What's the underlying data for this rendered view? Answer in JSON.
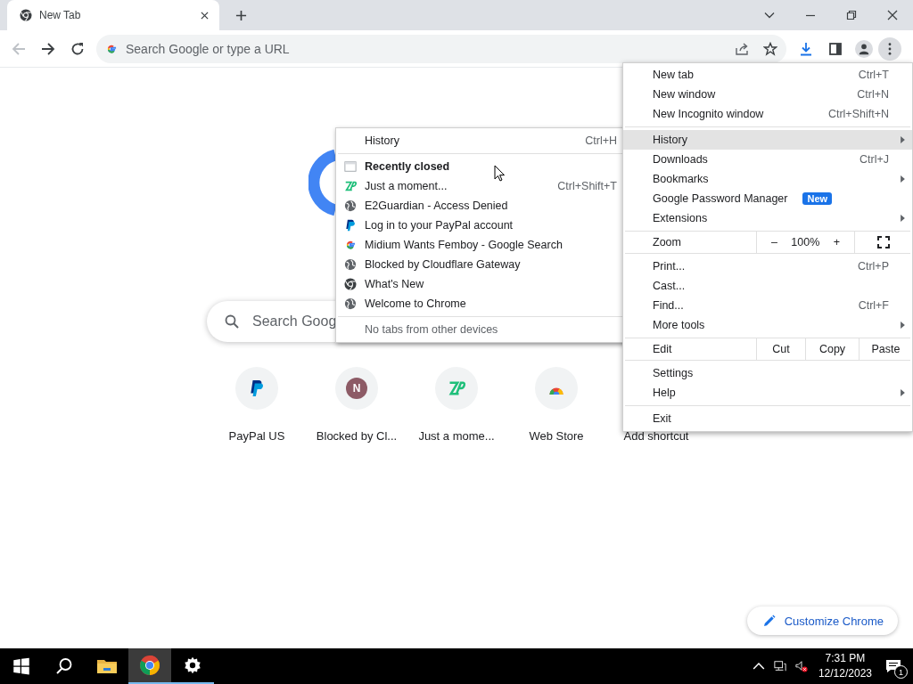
{
  "tab": {
    "title": "New Tab"
  },
  "address_bar": {
    "placeholder": "Search Google or type a URL"
  },
  "new_tab_page": {
    "search": {
      "placeholder": "Search Goog"
    },
    "shortcuts": [
      {
        "kind": "paypal",
        "label": "PayPal US"
      },
      {
        "kind": "letter",
        "letter": "N",
        "label": "Blocked by Cl..."
      },
      {
        "kind": "zp",
        "label": "Just a mome..."
      },
      {
        "kind": "webstore",
        "label": "Web Store"
      },
      {
        "kind": "add",
        "label": "Add shortcut"
      }
    ],
    "customize": {
      "label": "Customize Chrome"
    }
  },
  "main_menu": {
    "items": [
      {
        "kind": "item",
        "label": "New tab",
        "shortcut": "Ctrl+T",
        "submenu": false,
        "selected": false
      },
      {
        "kind": "item",
        "label": "New window",
        "shortcut": "Ctrl+N",
        "submenu": false,
        "selected": false
      },
      {
        "kind": "item",
        "label": "New Incognito window",
        "shortcut": "Ctrl+Shift+N",
        "submenu": false,
        "selected": false
      },
      {
        "kind": "separator"
      },
      {
        "kind": "item",
        "label": "History",
        "submenu": true,
        "selected": true
      },
      {
        "kind": "item",
        "label": "Downloads",
        "shortcut": "Ctrl+J",
        "submenu": false,
        "selected": false
      },
      {
        "kind": "item",
        "label": "Bookmarks",
        "submenu": true,
        "selected": false
      },
      {
        "kind": "item",
        "label": "Google Password Manager",
        "badge": "New",
        "submenu": false,
        "selected": false
      },
      {
        "kind": "item",
        "label": "Extensions",
        "submenu": true,
        "selected": false
      },
      {
        "kind": "separator"
      },
      {
        "kind": "zoom",
        "label": "Zoom",
        "minus": "–",
        "value": "100%",
        "plus": "+"
      },
      {
        "kind": "separator"
      },
      {
        "kind": "item",
        "label": "Print...",
        "shortcut": "Ctrl+P",
        "submenu": false,
        "selected": false
      },
      {
        "kind": "item",
        "label": "Cast...",
        "submenu": false,
        "selected": false
      },
      {
        "kind": "item",
        "label": "Find...",
        "shortcut": "Ctrl+F",
        "submenu": false,
        "selected": false
      },
      {
        "kind": "item",
        "label": "More tools",
        "submenu": true,
        "selected": false
      },
      {
        "kind": "separator"
      },
      {
        "kind": "edit",
        "label": "Edit",
        "actions": [
          "Cut",
          "Copy",
          "Paste"
        ]
      },
      {
        "kind": "separator"
      },
      {
        "kind": "item",
        "label": "Settings",
        "submenu": false,
        "selected": false
      },
      {
        "kind": "item",
        "label": "Help",
        "submenu": true,
        "selected": false
      },
      {
        "kind": "separator"
      },
      {
        "kind": "item",
        "label": "Exit",
        "submenu": false,
        "selected": false
      }
    ]
  },
  "history_submenu": {
    "items": [
      {
        "kind": "item",
        "label": "History",
        "shortcut": "Ctrl+H"
      },
      {
        "kind": "separator"
      },
      {
        "kind": "heading",
        "label": "Recently closed"
      },
      {
        "kind": "zp",
        "label": "Just a moment...",
        "shortcut": "Ctrl+Shift+T"
      },
      {
        "kind": "globe",
        "label": "E2Guardian - Access Denied"
      },
      {
        "kind": "paypal",
        "label": "Log in to your PayPal account"
      },
      {
        "kind": "google",
        "label": "Midium Wants Femboy - Google Search"
      },
      {
        "kind": "globe",
        "label": "Blocked by Cloudflare Gateway"
      },
      {
        "kind": "chrome",
        "label": "What's New"
      },
      {
        "kind": "globe",
        "label": "Welcome to Chrome"
      },
      {
        "kind": "separator"
      },
      {
        "kind": "note",
        "label": "No tabs from other devices"
      }
    ]
  },
  "taskbar": {
    "apps": [
      {
        "kind": "explorer",
        "running": false,
        "active": false
      },
      {
        "kind": "chrome",
        "running": true,
        "active": true
      },
      {
        "kind": "settings",
        "running": true,
        "active": false
      }
    ],
    "time": "7:31 PM",
    "date": "12/12/2023",
    "notifications": "1"
  }
}
